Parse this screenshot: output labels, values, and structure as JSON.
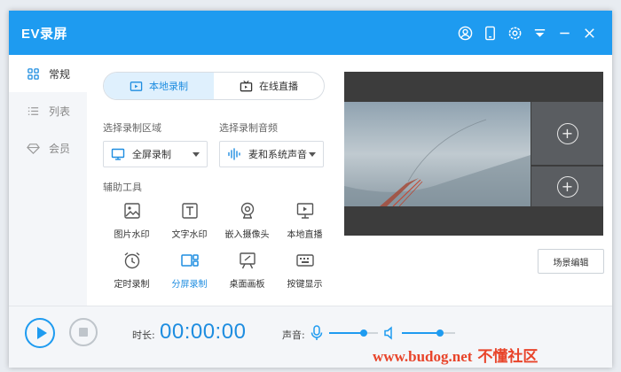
{
  "app": {
    "title": "EV录屏"
  },
  "titlebar": {
    "icons": [
      "user-icon",
      "phone-icon",
      "settings-icon",
      "menu-icon",
      "minimize-icon",
      "close-icon"
    ]
  },
  "sidebar": {
    "items": [
      {
        "label": "常规",
        "icon": "grid-icon",
        "active": true
      },
      {
        "label": "列表",
        "icon": "list-icon",
        "active": false
      },
      {
        "label": "会员",
        "icon": "diamond-icon",
        "active": false
      }
    ]
  },
  "mode": {
    "local": "本地录制",
    "live": "在线直播",
    "selected": "local"
  },
  "area": {
    "label": "选择录制区域",
    "value": "全屏录制"
  },
  "audio": {
    "label": "选择录制音频",
    "value": "麦和系统声音"
  },
  "tools": {
    "heading": "辅助工具",
    "items": [
      {
        "label": "图片水印",
        "icon": "image-icon"
      },
      {
        "label": "文字水印",
        "icon": "text-icon"
      },
      {
        "label": "嵌入摄像头",
        "icon": "webcam-icon"
      },
      {
        "label": "本地直播",
        "icon": "monitor-play-icon"
      },
      {
        "label": "定时录制",
        "icon": "alarm-clock-icon"
      },
      {
        "label": "分屏录制",
        "icon": "split-screen-icon",
        "selected": true
      },
      {
        "label": "桌面画板",
        "icon": "whiteboard-icon"
      },
      {
        "label": "按键显示",
        "icon": "keyboard-icon"
      }
    ]
  },
  "preview": {
    "scene_edit": "场景编辑"
  },
  "bottom": {
    "duration_label": "时长:",
    "duration": "00:00:00",
    "volume_label": "声音:",
    "mic_level": 0.7,
    "speaker_level": 0.72
  },
  "watermark": {
    "url": "www.budog.net",
    "text": "不懂社区"
  },
  "colors": {
    "accent": "#1e9bf0",
    "titlebar": "#1e9bf0"
  }
}
